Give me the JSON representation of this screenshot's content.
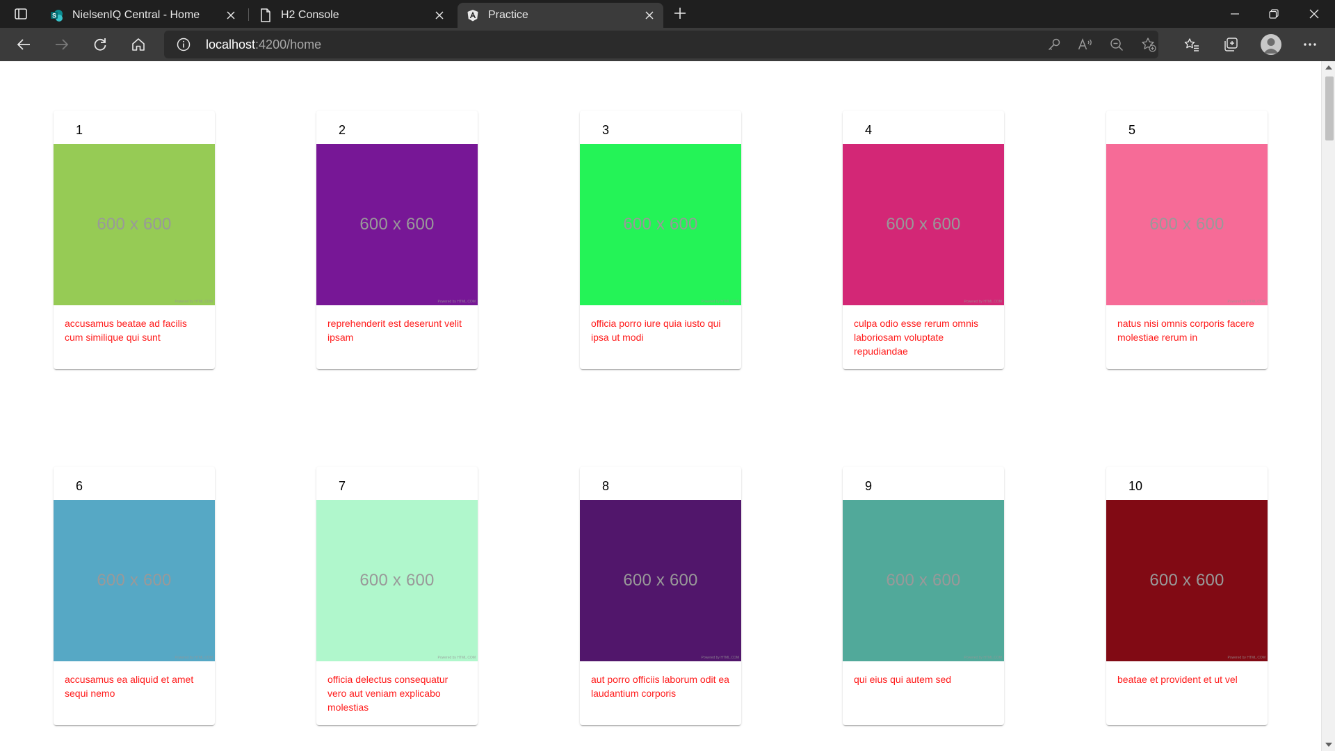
{
  "browser": {
    "tabs": [
      {
        "title": "NielsenIQ Central - Home",
        "icon": "sharepoint-icon",
        "active": false
      },
      {
        "title": "H2 Console",
        "icon": "page-icon",
        "active": false
      },
      {
        "title": "Practice",
        "icon": "angular-icon",
        "active": true
      }
    ],
    "address": {
      "host": "localhost",
      "path": ":4200/home"
    }
  },
  "cards": [
    {
      "number": "1",
      "image_text": "600 x 600",
      "image_color": "#96cb55",
      "caption": "accusamus beatae ad facilis cum similique qui sunt",
      "watermark": "Powered by HTML.COM"
    },
    {
      "number": "2",
      "image_text": "600 x 600",
      "image_color": "#771796",
      "caption": "reprehenderit est deserunt velit ipsam",
      "watermark": "Powered by HTML.COM"
    },
    {
      "number": "3",
      "image_text": "600 x 600",
      "image_color": "#24f357",
      "caption": "officia porro iure quia iusto qui ipsa ut modi",
      "watermark": "Powered by HTML.COM"
    },
    {
      "number": "4",
      "image_text": "600 x 600",
      "image_color": "#d32776",
      "caption": "culpa odio esse rerum omnis laboriosam voluptate repudiandae",
      "watermark": "Powered by HTML.COM"
    },
    {
      "number": "5",
      "image_text": "600 x 600",
      "image_color": "#f66b97",
      "caption": "natus nisi omnis corporis facere molestiae rerum in",
      "watermark": "Powered by HTML.COM"
    },
    {
      "number": "6",
      "image_text": "600 x 600",
      "image_color": "#56a8c5",
      "caption": "accusamus ea aliquid et amet sequi nemo",
      "watermark": "Powered by HTML.COM"
    },
    {
      "number": "7",
      "image_text": "600 x 600",
      "image_color": "#b0f7cc",
      "caption": "officia delectus consequatur vero aut veniam explicabo molestias",
      "watermark": "Powered by HTML.COM"
    },
    {
      "number": "8",
      "image_text": "600 x 600",
      "image_color": "#51166b",
      "caption": "aut porro officiis laborum odit ea laudantium corporis",
      "watermark": "Powered by HTML.COM"
    },
    {
      "number": "9",
      "image_text": "600 x 600",
      "image_color": "#51a99a",
      "caption": "qui eius qui autem sed",
      "watermark": "Powered by HTML.COM"
    },
    {
      "number": "10",
      "image_text": "600 x 600",
      "image_color": "#810a14",
      "caption": "beatae et provident et ut vel",
      "watermark": "Powered by HTML.COM"
    }
  ]
}
